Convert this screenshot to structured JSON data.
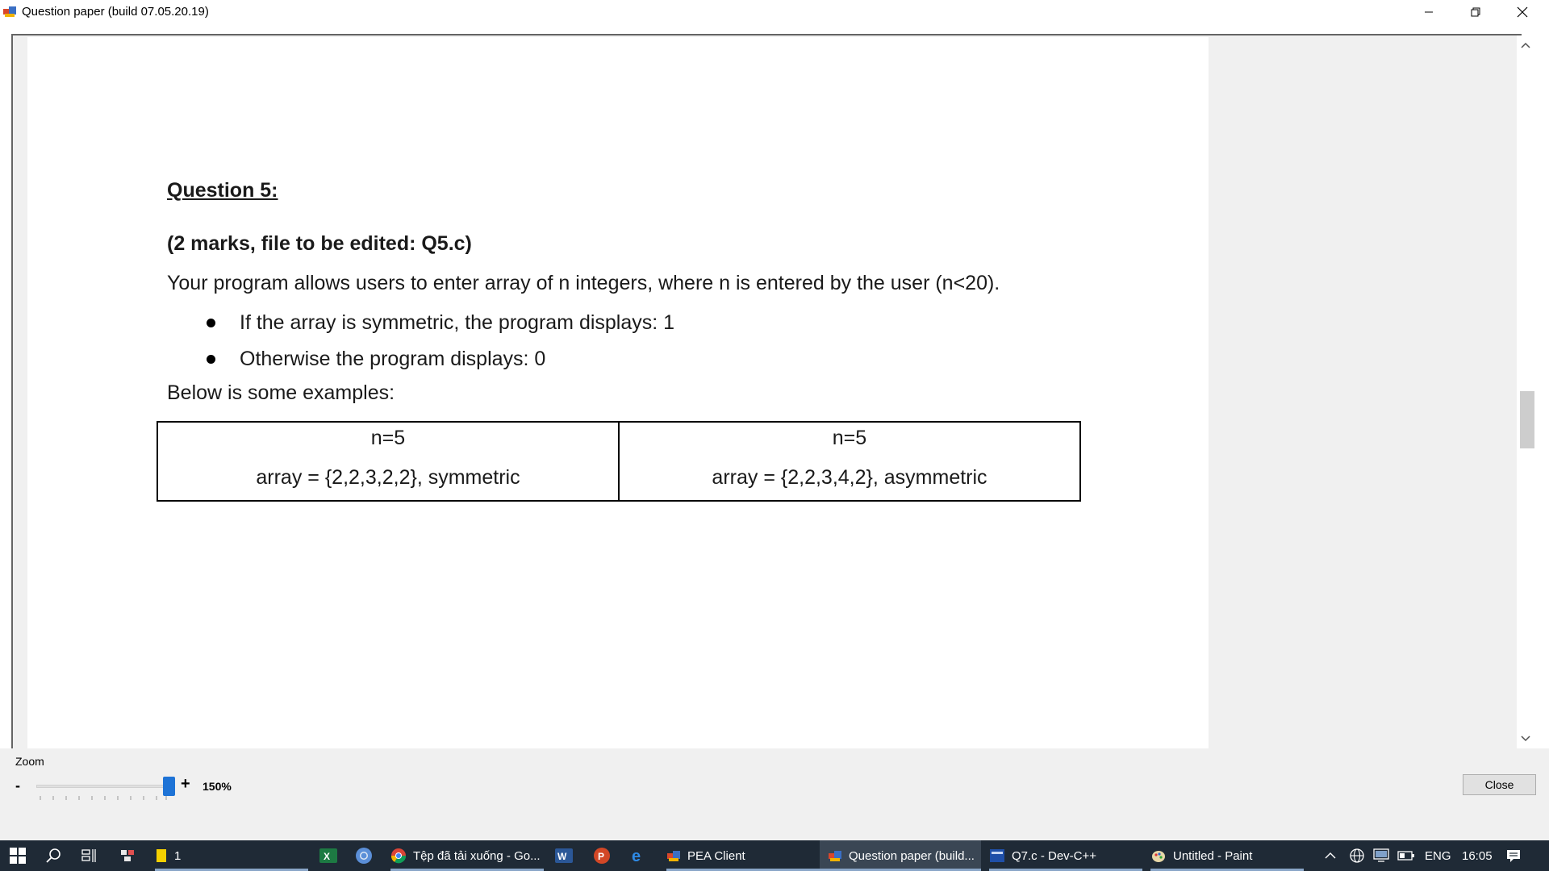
{
  "window": {
    "title": "Question paper (build 07.05.20.19)"
  },
  "document": {
    "question_title": "Question 5:",
    "marks": "(2 marks, file to be edited: Q5.c)",
    "description": "Your program allows users to enter array of n integers, where n is entered by the user (n<20).",
    "bullets": [
      "If the array is symmetric, the program displays: 1",
      "Otherwise the program displays: 0"
    ],
    "examples_intro": "Below is some examples:",
    "examples": [
      {
        "n": "n=5",
        "array": "array = {2,2,3,2,2}, symmetric"
      },
      {
        "n": "n=5",
        "array": "array = {2,2,3,4,2}, asymmetric"
      }
    ]
  },
  "zoom": {
    "label": "Zoom",
    "minus": "-",
    "plus": "+",
    "value": "150%",
    "slider_level": 1.0
  },
  "close_label": "Close",
  "taskbar": {
    "items": [
      {
        "label": "1",
        "icon": "sticky-notes-icon"
      },
      {
        "label": "",
        "icon": "excel-icon"
      },
      {
        "label": "",
        "icon": "chrome-icon"
      },
      {
        "label": "Tệp đã tải xuống - Go...",
        "icon": "chrome-icon"
      },
      {
        "label": "",
        "icon": "word-icon"
      },
      {
        "label": "",
        "icon": "powerpoint-icon"
      },
      {
        "label": "",
        "icon": "edge-icon"
      },
      {
        "label": "PEA Client",
        "icon": "pea-client-icon"
      },
      {
        "label": "Question paper (build...",
        "icon": "question-paper-icon"
      },
      {
        "label": "Q7.c - Dev-C++",
        "icon": "devcpp-icon"
      },
      {
        "label": "Untitled - Paint",
        "icon": "paint-icon"
      }
    ],
    "tray": {
      "language": "ENG",
      "time": "16:05"
    }
  },
  "colors": {
    "taskbar_bg": "#1f2a36",
    "slider_thumb": "#1e73d6"
  }
}
